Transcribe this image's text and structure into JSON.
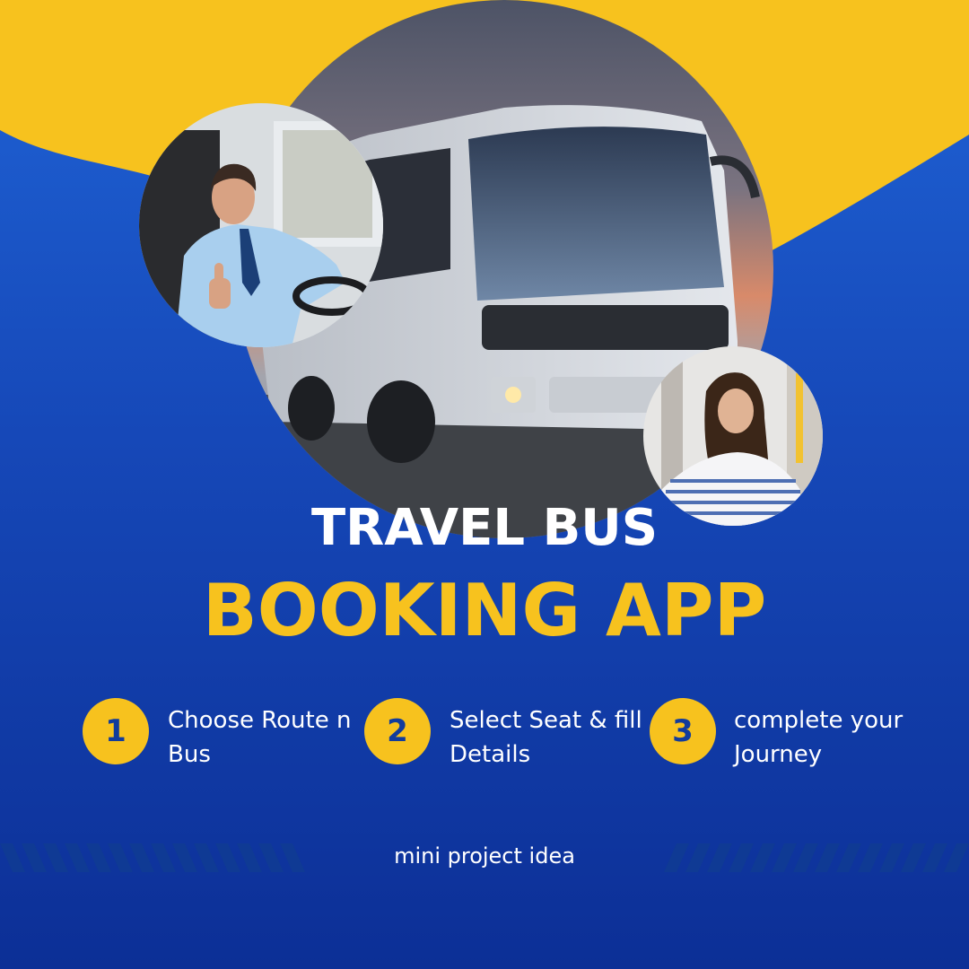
{
  "colors": {
    "yellow": "#f7c21e",
    "blue_top": "#1f63d6",
    "blue_bottom": "#0c2f96",
    "white": "#ffffff"
  },
  "images": {
    "bus": "bus-photo",
    "driver": "driver-thumbs-up-photo",
    "passenger": "smiling-passenger-photo"
  },
  "title": {
    "line1": "TRAVEL BUS",
    "line2": "BOOKING APP"
  },
  "steps": [
    {
      "number": "1",
      "text": "Choose Route n Bus"
    },
    {
      "number": "2",
      "text": "Select Seat & fill Details"
    },
    {
      "number": "3",
      "text": "complete your Journey"
    }
  ],
  "footer": "mini project idea"
}
